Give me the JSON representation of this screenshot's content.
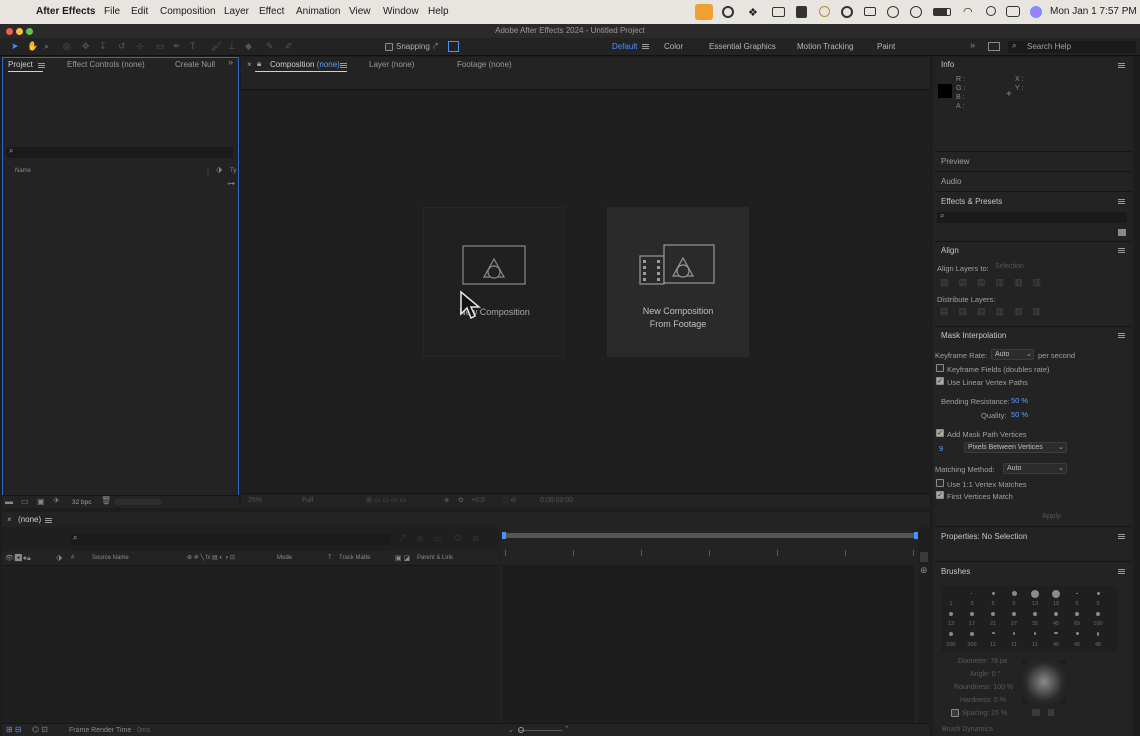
{
  "menubar": {
    "app": "After Effects",
    "items": [
      "File",
      "Edit",
      "Composition",
      "Layer",
      "Effect",
      "Animation",
      "View",
      "Window",
      "Help"
    ],
    "clock": "Mon Jan 1  7:57 PM"
  },
  "window": {
    "title": "Adobe After Effects 2024 - Untitled Project"
  },
  "toolbar": {
    "snapping": "Snapping",
    "workspaces": [
      "Default",
      "Color",
      "Essential Graphics",
      "Motion Tracking",
      "Paint"
    ],
    "search": "Search Help"
  },
  "project": {
    "tabs": [
      "Project",
      "Effect Controls (none)",
      "Create Null"
    ],
    "col_name": "Name",
    "col_type": "Ty",
    "bpc": "32 bpc"
  },
  "comp": {
    "tabs": [
      "Composition (none)",
      "Layer (none)",
      "Footage (none)"
    ],
    "tab_comp": "Composition",
    "tab_comp_none": "(none)",
    "new_comp": "New Composition",
    "new_from_footage_1": "New Composition",
    "new_from_footage_2": "From Footage",
    "zoom": "25%",
    "res": "Full",
    "exposure": "+0.0",
    "timecode": "0:00:00:00"
  },
  "info": {
    "title": "Info",
    "rgba": [
      "R :",
      "G :",
      "B :",
      "A :"
    ],
    "xy": [
      "X :",
      "Y :"
    ]
  },
  "sections": {
    "preview": "Preview",
    "audio": "Audio",
    "effects": "Effects & Presets",
    "align": "Align",
    "align_to": "Align Layers to:",
    "selection": "Selection",
    "distribute": "Distribute Layers:",
    "mask": "Mask Interpolation",
    "props": "Properties: No Selection",
    "brushes": "Brushes"
  },
  "mask": {
    "keyframe_rate": "Keyframe Rate:",
    "rate_val": "Auto",
    "per_sec": "per second",
    "fields": "Keyframe Fields (doubles rate)",
    "linear": "Use Linear Vertex Paths",
    "bending": "Bending Resistance:",
    "bending_val": "50 %",
    "quality": "Quality:",
    "quality_val": "50 %",
    "add_vertices": "Add Mask Path Vertices",
    "vert_num": "9",
    "vert_mode": "Pixels Between Vertices",
    "matching": "Matching Method:",
    "match_val": "Auto",
    "one_one": "Use 1:1 Vertex Matches",
    "first": "First Vertices Match",
    "apply": "Apply"
  },
  "brushes": {
    "row1": [
      "1",
      "3",
      "5",
      "9",
      "13",
      "19",
      "5",
      "9"
    ],
    "row2": [
      "13",
      "17",
      "21",
      "27",
      "35",
      "45",
      "65",
      "100"
    ],
    "row3": [
      "200",
      "300",
      "11",
      "11",
      "11",
      "45",
      "45",
      "45"
    ],
    "diameter": "Diameter: 78 px",
    "angle": "Angle: 0 °",
    "roundness": "Roundness: 100 %",
    "hardness": "Hardness: 0 %",
    "spacing": "Spacing: 25 %",
    "dynamics": "Brush Dynamics"
  },
  "timeline": {
    "tab": "(none)",
    "cols": [
      "#",
      "Source Name",
      "Mode",
      "T",
      "Track Matte",
      "Parent & Link"
    ],
    "status": "Frame Render Time",
    "status_val": "0ms"
  }
}
